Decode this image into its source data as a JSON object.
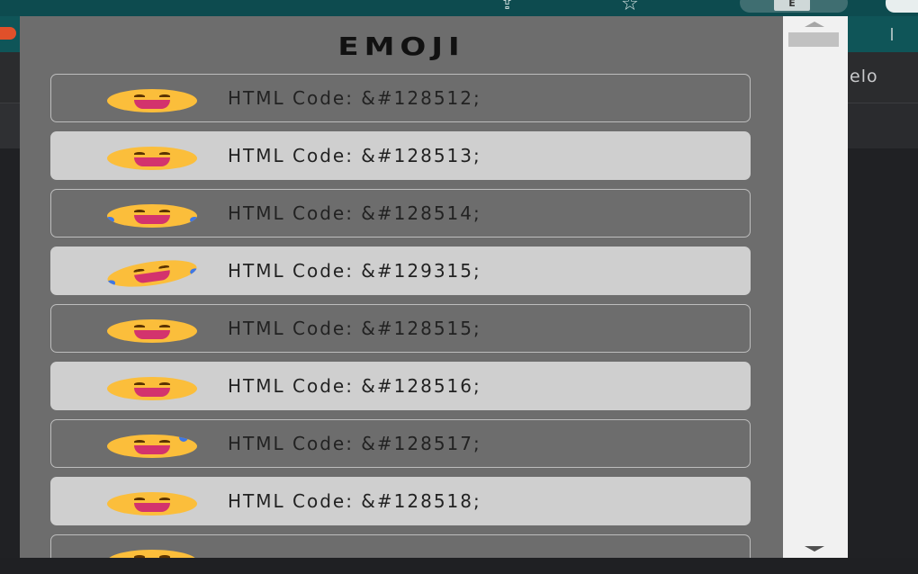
{
  "browser": {
    "extension_badge": "E",
    "side_text": "elo"
  },
  "popup": {
    "title": "EMOJI",
    "items": [
      {
        "code": "HTML Code: &#128512;",
        "face": "grinning-face"
      },
      {
        "code": "HTML Code: &#128513;",
        "face": "beaming-face"
      },
      {
        "code": "HTML Code: &#128514;",
        "face": "tears-of-joy-face"
      },
      {
        "code": "HTML Code: &#129315;",
        "face": "rolling-laughing-face"
      },
      {
        "code": "HTML Code: &#128515;",
        "face": "grinning-big-eyes-face"
      },
      {
        "code": "HTML Code: &#128516;",
        "face": "grinning-smiling-eyes-face"
      },
      {
        "code": "HTML Code: &#128517;",
        "face": "grinning-sweat-face"
      },
      {
        "code": "HTML Code: &#128518;",
        "face": "squinting-face"
      },
      {
        "code": "",
        "face": "partially-visible-face"
      }
    ]
  },
  "colors": {
    "popup_bg": "#6d6d6d",
    "row_light": "#cfcfcf",
    "emoji_yellow": "#fbbe3b",
    "mouth": "#d3336d",
    "tear_blue": "#3e77e6"
  }
}
